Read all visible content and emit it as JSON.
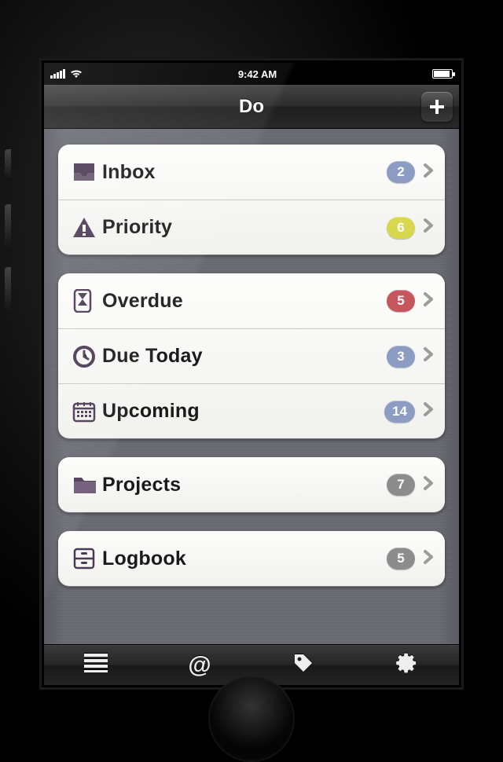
{
  "statusbar": {
    "time": "9:42 AM"
  },
  "navbar": {
    "title": "Do",
    "add_label": "+"
  },
  "badge_colors": {
    "blue": "#8c9cc2",
    "yellow": "#d7d84e",
    "red": "#c6565e",
    "gray": "#8c8c8c"
  },
  "groups": [
    {
      "rows": [
        {
          "id": "inbox",
          "icon": "inbox-icon",
          "label": "Inbox",
          "count": 2,
          "color": "blue"
        },
        {
          "id": "priority",
          "icon": "alert-icon",
          "label": "Priority",
          "count": 6,
          "color": "yellow"
        }
      ]
    },
    {
      "rows": [
        {
          "id": "overdue",
          "icon": "hourglass-icon",
          "label": "Overdue",
          "count": 5,
          "color": "red"
        },
        {
          "id": "duetoday",
          "icon": "clock-icon",
          "label": "Due Today",
          "count": 3,
          "color": "blue"
        },
        {
          "id": "upcoming",
          "icon": "calendar-icon",
          "label": "Upcoming",
          "count": 14,
          "color": "blue"
        }
      ]
    },
    {
      "rows": [
        {
          "id": "projects",
          "icon": "folder-icon",
          "label": "Projects",
          "count": 7,
          "color": "gray"
        }
      ]
    },
    {
      "rows": [
        {
          "id": "logbook",
          "icon": "archive-icon",
          "label": "Logbook",
          "count": 5,
          "color": "gray"
        }
      ]
    }
  ],
  "toolbar": {
    "items": [
      {
        "id": "list",
        "icon": "list-icon"
      },
      {
        "id": "at",
        "icon": "at-icon"
      },
      {
        "id": "tag",
        "icon": "tag-icon"
      },
      {
        "id": "settings",
        "icon": "gear-icon"
      }
    ]
  }
}
